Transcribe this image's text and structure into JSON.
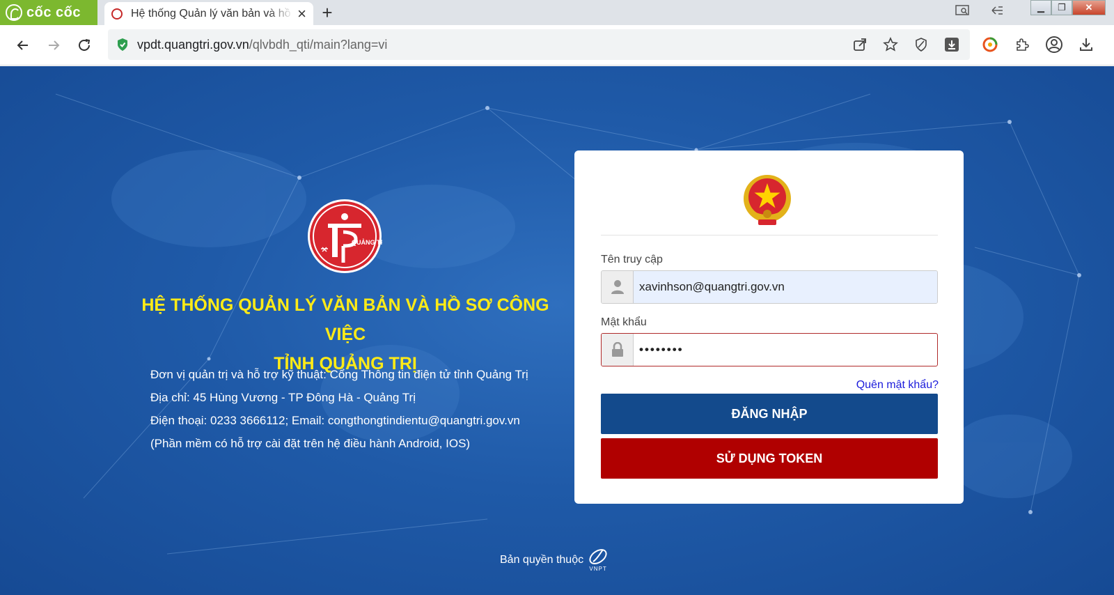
{
  "browser": {
    "brand": "cốc cốc",
    "tab_title": "Hệ thống Quản lý văn bản và hồ sơ công việc",
    "url_host": "vpdt.quangtri.gov.vn",
    "url_path": "/qlvbdh_qti/main?lang=vi"
  },
  "left": {
    "logo_text": "QUẢNG TRỊ",
    "title_line1": "HỆ THỐNG QUẢN LÝ VĂN BẢN VÀ HỒ SƠ CÔNG VIỆC",
    "title_line2": "TỈNH QUẢNG TRỊ",
    "info": [
      "Đơn vị quản trị và hỗ trợ kỹ thuật: Cổng Thông tin điện tử tỉnh Quảng Trị",
      "Địa chỉ: 45 Hùng Vương - TP Đông Hà - Quảng Trị",
      "Điện thoại: 0233 3666112; Email: congthongtindientu@quangtri.gov.vn",
      "(Phần mềm có hỗ trợ cài đặt trên hệ điều hành Android, IOS)"
    ]
  },
  "login": {
    "username_label": "Tên truy cập",
    "username_value": "xavinhson@quangtri.gov.vn",
    "password_label": "Mật khẩu",
    "password_value": "••••••••",
    "forgot_label": "Quên mật khẩu?",
    "login_button": "ĐĂNG NHẬP",
    "token_button": "SỬ DỤNG TOKEN"
  },
  "footer": {
    "copyright": "Bản quyền thuộc",
    "vnpt": "VNPT"
  },
  "colors": {
    "accent_blue": "#134a8c",
    "token_red": "#b00000",
    "title_yellow": "#ffeb16"
  }
}
